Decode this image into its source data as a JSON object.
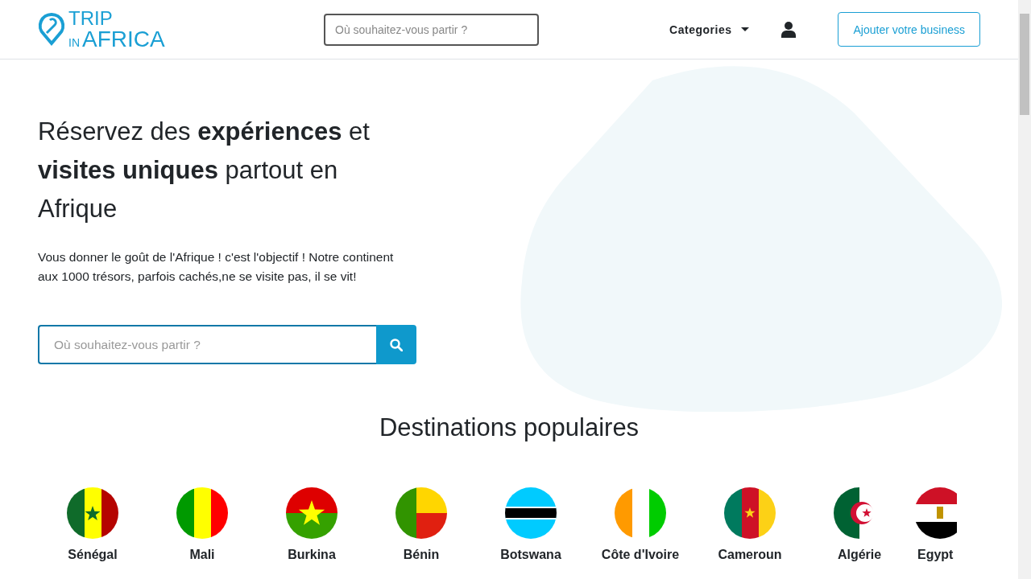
{
  "header": {
    "logo": {
      "top": "TRIP",
      "small": "IN",
      "bottom": "AFRICA"
    },
    "search": {
      "placeholder": "Où souhaitez-vous partir ?"
    },
    "menu": {
      "label": "Categories"
    },
    "cta": "Ajouter votre business"
  },
  "hero": {
    "title": "Réservez des **expériences** et **visites uniques** partout en Afrique",
    "text": "Vous donner le goût de l'Afrique ! c'est l'objectif ! Notre continent aux 1000 trésors, parfois cachés,ne se visite pas, il se vit!",
    "search": {
      "placeholder": "Où souhaitez-vous partir ?"
    }
  },
  "destinations": {
    "title": "Destinations populaires",
    "items": [
      {
        "name": "Sénégal",
        "kind": "senegal"
      },
      {
        "name": "Mali",
        "kind": "mali"
      },
      {
        "name": "Burkina",
        "kind": "burkina"
      },
      {
        "name": "Bénin",
        "kind": "benin"
      },
      {
        "name": "Botswana",
        "kind": "botswana"
      },
      {
        "name": "Côte d'Ivoire",
        "kind": "ivory"
      },
      {
        "name": "Cameroun",
        "kind": "cameroon"
      },
      {
        "name": "Algérie",
        "kind": "algeria"
      },
      {
        "name": "Egypt",
        "kind": "egypt"
      }
    ]
  }
}
